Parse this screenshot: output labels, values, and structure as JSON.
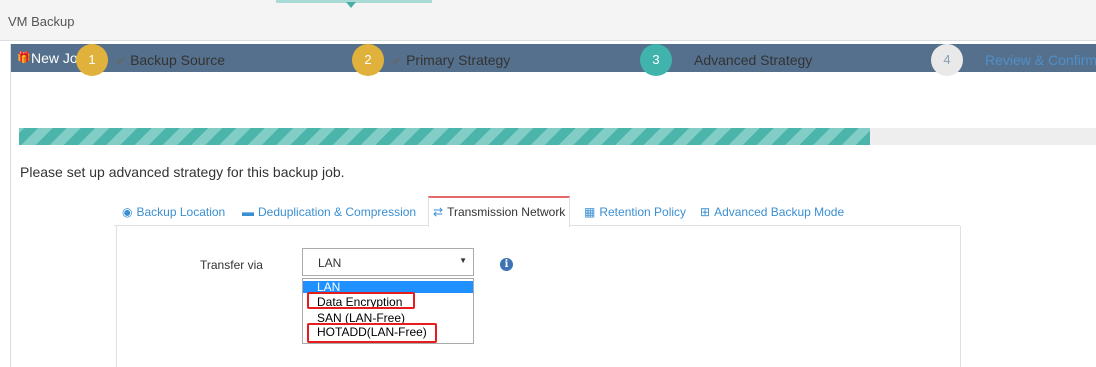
{
  "page": {
    "title": "VM Backup"
  },
  "panel": {
    "title": "New Job",
    "icon": "gift-icon"
  },
  "steps": [
    {
      "number": "1",
      "label": "Backup Source",
      "done": true,
      "color": "#e1b23b"
    },
    {
      "number": "2",
      "label": "Primary Strategy",
      "done": true,
      "color": "#e1b23b"
    },
    {
      "number": "3",
      "label": "Advanced Strategy",
      "done": false,
      "color": "#3fb3ac"
    },
    {
      "number": "4",
      "label": "Review & Confirm",
      "done": false,
      "color": "#e9e9e9"
    }
  ],
  "instruction": "Please set up advanced strategy for this backup job.",
  "tabs": [
    {
      "label": "Backup Location",
      "icon": "map-pin-icon"
    },
    {
      "label": "Deduplication & Compression",
      "icon": "disk-icon"
    },
    {
      "label": "Transmission Network",
      "icon": "exchange-icon",
      "active": true
    },
    {
      "label": "Retention Policy",
      "icon": "trash-icon"
    },
    {
      "label": "Advanced Backup Mode",
      "icon": "grid-icon"
    }
  ],
  "form": {
    "transfer_label": "Transfer via",
    "selected": "LAN",
    "options": [
      "LAN",
      "Data Encryption",
      "SAN (LAN-Free)",
      "HOTADD(LAN-Free)"
    ]
  },
  "colors": {
    "header": "#55708c",
    "accent": "#3fb3ac",
    "link": "#3a8fd2",
    "highlight": "#e51d1d"
  }
}
